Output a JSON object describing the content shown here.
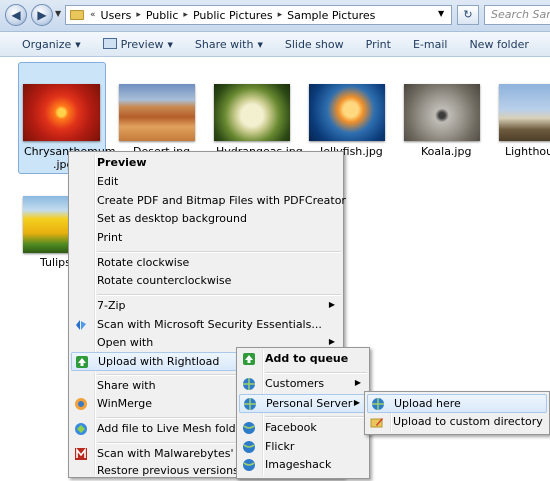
{
  "address_bar": {
    "breadcrumbs": [
      "Users",
      "Public",
      "Public Pictures",
      "Sample Pictures"
    ],
    "search_placeholder": "Search Samp"
  },
  "toolbar": {
    "organize": "Organize",
    "preview": "Preview",
    "share_with": "Share with",
    "slide_show": "Slide show",
    "print": "Print",
    "email": "E-mail",
    "new_folder": "New folder"
  },
  "files": [
    {
      "line1": "Chrysanthemum",
      "line2": ".jpg"
    },
    {
      "line1": "Desert.jpg",
      "line2": ""
    },
    {
      "line1": "Hydrangeas.jpg",
      "line2": ""
    },
    {
      "line1": "Jellyfish.jpg",
      "line2": ""
    },
    {
      "line1": "Koala.jpg",
      "line2": ""
    },
    {
      "line1": "Lighthous",
      "line2": ""
    },
    {
      "line1": "Tulips",
      "line2": ""
    }
  ],
  "context_menu": {
    "preview": "Preview",
    "edit": "Edit",
    "pdf": "Create PDF and Bitmap Files with PDFCreator",
    "desktop_bg": "Set as desktop background",
    "print": "Print",
    "rotate_cw": "Rotate clockwise",
    "rotate_ccw": "Rotate counterclockwise",
    "zip": "7-Zip",
    "scan_mse": "Scan with Microsoft Security Essentials...",
    "open_with": "Open with",
    "rightload": "Upload with Rightload",
    "share_with": "Share with",
    "winmerge": "WinMerge",
    "live_mesh": "Add file to Live Mesh folder...",
    "malwarebytes": "Scan with Malwarebytes' Anti-M",
    "restore": "Restore previous versions"
  },
  "rightload_menu": {
    "add_to_queue": "Add to queue",
    "customers": "Customers",
    "personal_server": "Personal Server",
    "facebook": "Facebook",
    "flickr": "Flickr",
    "imageshack": "Imageshack"
  },
  "server_menu": {
    "upload_here": "Upload here",
    "upload_custom": "Upload to custom directory"
  },
  "colors": {
    "selection": "#cce4f8",
    "menu_highlight": "#d9e9fa",
    "menu_bg": "#f0f0f0"
  }
}
